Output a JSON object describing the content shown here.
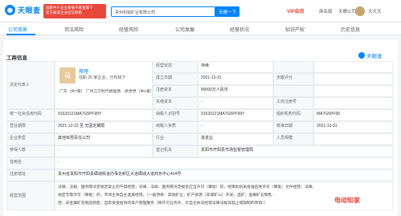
{
  "header": {
    "logo_text": "天眼查",
    "badge_line1": "国家中小企业发展子基金旗下",
    "badge_line2": "官方备案企业征信机构",
    "search_value": "贵州钧铭矿业有限公司",
    "search_button": "天眼一下",
    "vip": "VIP会员",
    "nav": [
      "商业版",
      "天眼公司",
      "大大大"
    ]
  },
  "tabs": [
    "公司背景",
    "司法风险",
    "经营风险",
    "公司发展",
    "经营状况",
    "知识产权",
    "历史信息"
  ],
  "card": {
    "title": "工商信息",
    "watermark": "天眼查",
    "legal_rep_label": "法定代表人",
    "person": {
      "initial": "蒋",
      "name": "蒋理",
      "sub1": "任职 25 家企业，分布如下",
      "sub2": "广东（共7家）  广州江宁时代新能源... 新世界（共1家）"
    },
    "rows": [
      {
        "l1": "经营状态",
        "v1": "存续",
        "l2": "",
        "v2": ""
      },
      {
        "l1": "成立日期",
        "v1": "2021-12-31",
        "l2": "天眼评分",
        "v2": ""
      },
      {
        "l1": "注册资本",
        "v1": "80000万人民币",
        "l2": "",
        "v2": ""
      },
      {
        "l1": "实缴资本",
        "v1": "-",
        "l2": "工商注册号",
        "v2": ""
      }
    ],
    "rows2": [
      {
        "a": "统一社会信用代码",
        "b": "91520121MA7G5PF99Y",
        "c": "纳税人识别号",
        "d": "91520121MA7G5PF99Y",
        "e": "组织机构代码",
        "f": "MA7G5PF99"
      },
      {
        "a": "营业期限",
        "b": "2021-12-31 至 无固定期限",
        "c": "纳税人资质",
        "d": "-",
        "e": "核准日期",
        "f": "2021-12-31"
      },
      {
        "a": "企业类型",
        "b": "其他有限责任公司",
        "c": "行业",
        "d": "批发业",
        "e": "人员规模",
        "f": ""
      },
      {
        "a": "参保人数",
        "b": "-",
        "c": "登记机关",
        "d": "贵阳市开阳县市场监督管理局",
        "e": "",
        "f": ""
      },
      {
        "a": "曾用名",
        "b": "-",
        "c": "",
        "d": "",
        "e": "",
        "f": ""
      }
    ],
    "address_label": "注册地址",
    "address": "贵州省贵阳市开阳县硒城街道办事处新区大道硒城大道商务中心434号",
    "scope_label": "经营范围",
    "scope_line1": "法律、法规、国务院决定规定禁止的不得经营；法律、法规、国务院决定规定应当许可（审批）的，经审批机关批准后凭许可（审批）文件经营；法律、",
    "scope_line2": "规定无需许可（审批）的，市场主体自主选择经营。（一般项目：其他矿业；矿产资源（非煤矿山）开采；选矿；金属矿石销售...",
    "scope_line3": "营；非金属矿及制品销售；自有资金投资的资产管理服务（除许可业务外，可自主依法经营法律法规非禁止或限制的项目））",
    "footer_watermark": "电动知家"
  }
}
